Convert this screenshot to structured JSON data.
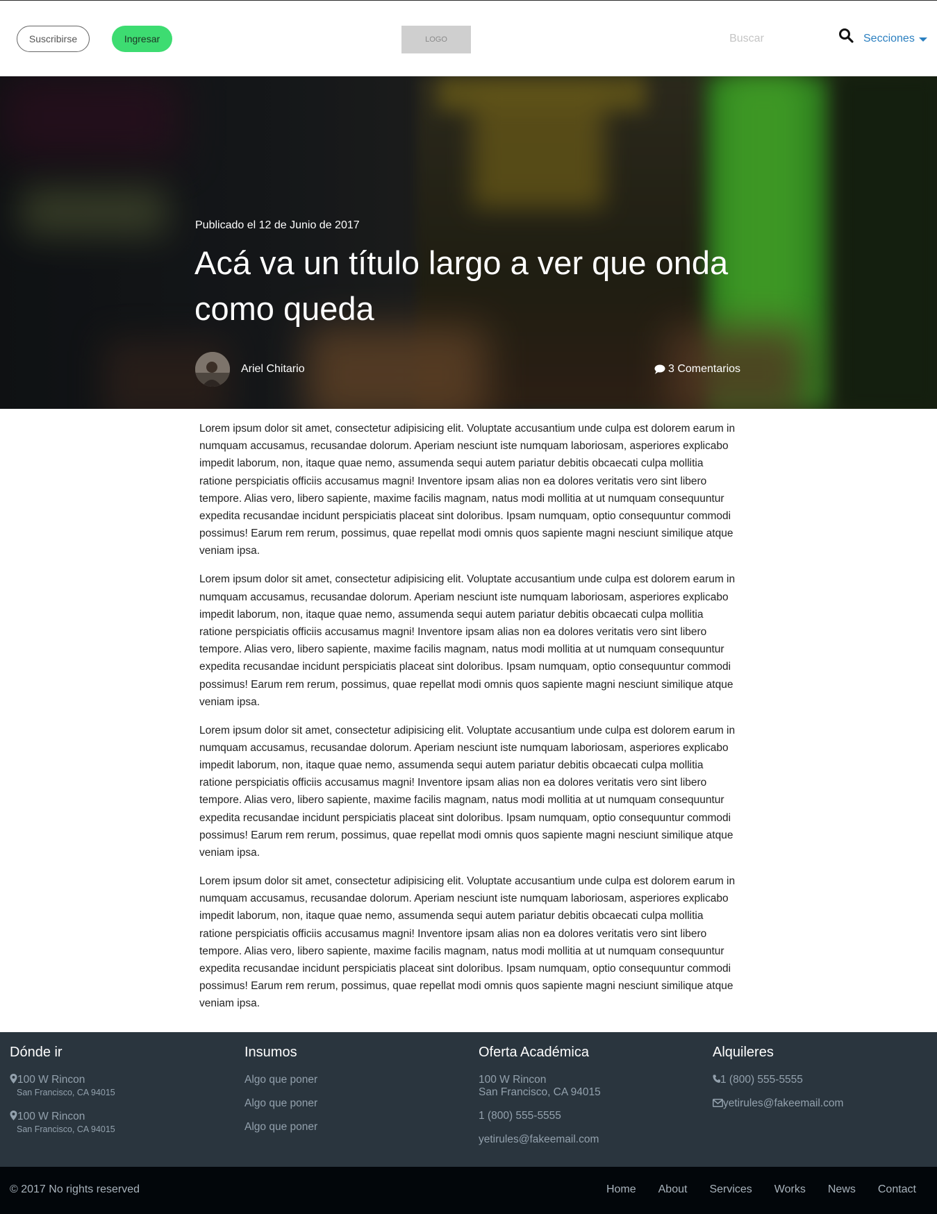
{
  "header": {
    "subscribe_label": "Suscribirse",
    "login_label": "Ingresar",
    "logo_text": "LOGO",
    "search_placeholder": "Buscar",
    "sections_label": "Secciones"
  },
  "hero": {
    "published": "Publicado el 12 de Junio de 2017",
    "title": "Acá va un título largo a ver que onda como queda",
    "author": "Ariel Chitario",
    "comments": "3 Comentarios"
  },
  "article": {
    "paragraphs": [
      "Lorem ipsum dolor sit amet, consectetur adipisicing elit. Voluptate accusantium unde culpa est dolorem earum in numquam accusamus, recusandae dolorum. Aperiam nesciunt iste numquam laboriosam, asperiores explicabo impedit laborum, non, itaque quae nemo, assumenda sequi autem pariatur debitis obcaecati culpa mollitia ratione perspiciatis officiis accusamus magni! Inventore ipsam alias non ea dolores veritatis vero sint libero tempore. Alias vero, libero sapiente, maxime facilis magnam, natus modi mollitia at ut numquam consequuntur expedita recusandae incidunt perspiciatis placeat sint doloribus. Ipsam numquam, optio consequuntur commodi possimus! Earum rem rerum, possimus, quae repellat modi omnis quos sapiente magni nesciunt similique atque veniam ipsa.",
      "Lorem ipsum dolor sit amet, consectetur adipisicing elit. Voluptate accusantium unde culpa est dolorem earum in numquam accusamus, recusandae dolorum. Aperiam nesciunt iste numquam laboriosam, asperiores explicabo impedit laborum, non, itaque quae nemo, assumenda sequi autem pariatur debitis obcaecati culpa mollitia ratione perspiciatis officiis accusamus magni! Inventore ipsam alias non ea dolores veritatis vero sint libero tempore. Alias vero, libero sapiente, maxime facilis magnam, natus modi mollitia at ut numquam consequuntur expedita recusandae incidunt perspiciatis placeat sint doloribus. Ipsam numquam, optio consequuntur commodi possimus! Earum rem rerum, possimus, quae repellat modi omnis quos sapiente magni nesciunt similique atque veniam ipsa.",
      "Lorem ipsum dolor sit amet, consectetur adipisicing elit. Voluptate accusantium unde culpa est dolorem earum in numquam accusamus, recusandae dolorum. Aperiam nesciunt iste numquam laboriosam, asperiores explicabo impedit laborum, non, itaque quae nemo, assumenda sequi autem pariatur debitis obcaecati culpa mollitia ratione perspiciatis officiis accusamus magni! Inventore ipsam alias non ea dolores veritatis vero sint libero tempore. Alias vero, libero sapiente, maxime facilis magnam, natus modi mollitia at ut numquam consequuntur expedita recusandae incidunt perspiciatis placeat sint doloribus. Ipsam numquam, optio consequuntur commodi possimus! Earum rem rerum, possimus, quae repellat modi omnis quos sapiente magni nesciunt similique atque veniam ipsa.",
      "Lorem ipsum dolor sit amet, consectetur adipisicing elit. Voluptate accusantium unde culpa est dolorem earum in numquam accusamus, recusandae dolorum. Aperiam nesciunt iste numquam laboriosam, asperiores explicabo impedit laborum, non, itaque quae nemo, assumenda sequi autem pariatur debitis obcaecati culpa mollitia ratione perspiciatis officiis accusamus magni! Inventore ipsam alias non ea dolores veritatis vero sint libero tempore. Alias vero, libero sapiente, maxime facilis magnam, natus modi mollitia at ut numquam consequuntur expedita recusandae incidunt perspiciatis placeat sint doloribus. Ipsam numquam, optio consequuntur commodi possimus! Earum rem rerum, possimus, quae repellat modi omnis quos sapiente magni nesciunt similique atque veniam ipsa."
    ]
  },
  "footer": {
    "col1": {
      "title": "Dónde ir",
      "locations": [
        {
          "street": "100 W Rincon",
          "city": "San Francisco, CA 94015"
        },
        {
          "street": "100 W Rincon",
          "city": "San Francisco, CA 94015"
        }
      ]
    },
    "col2": {
      "title": "Insumos",
      "links": [
        "Algo que poner",
        "Algo que poner",
        "Algo que poner"
      ]
    },
    "col3": {
      "title": "Oferta Académica",
      "street": "100 W Rincon",
      "city": "San Francisco, CA 94015",
      "phone": "1 (800) 555-5555",
      "email": "yetirules@fakeemail.com"
    },
    "col4": {
      "title": "Alquileres",
      "phone": "1 (800) 555-5555",
      "email": "yetirules@fakeemail.com"
    }
  },
  "bottom": {
    "copyright": "© 2017 No rights reserved",
    "nav": [
      "Home",
      "About",
      "Services",
      "Works",
      "News",
      "Contact"
    ]
  },
  "icons": {
    "search": "search-icon",
    "sections_chevron": "chevron-down-icon",
    "comments": "comment-icon",
    "location": "map-marker-icon",
    "phone": "phone-icon",
    "email": "envelope-icon"
  },
  "colors": {
    "login_button": "#3ddc71",
    "link_blue": "#2a7fc0",
    "footer_bg": "#2a353e",
    "bottom_bar_bg": "#02060a",
    "footer_text": "#93a1ad"
  }
}
